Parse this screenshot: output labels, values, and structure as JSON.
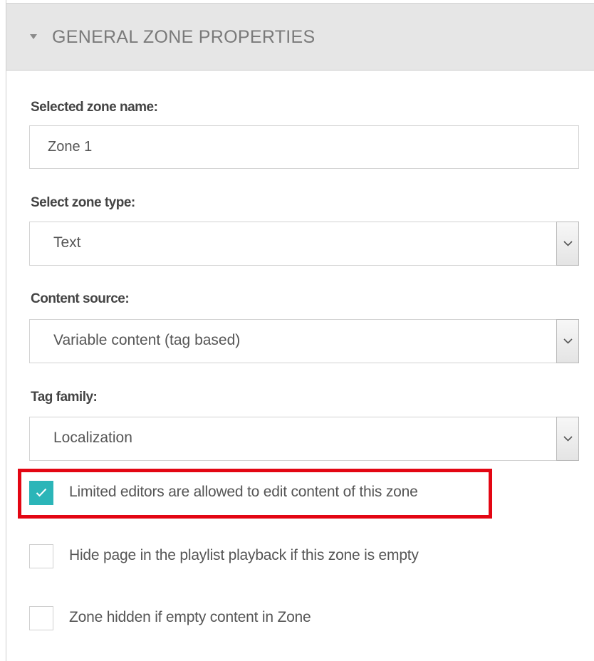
{
  "panel": {
    "title": "GENERAL ZONE PROPERTIES"
  },
  "fields": {
    "zone_name": {
      "label": "Selected zone name:",
      "value": "Zone 1"
    },
    "zone_type": {
      "label": "Select zone type:",
      "value": "Text"
    },
    "content_source": {
      "label": "Content source:",
      "value": "Variable content (tag based)"
    },
    "tag_family": {
      "label": "Tag family:",
      "value": "Localization"
    }
  },
  "checkboxes": [
    {
      "label": "Limited editors are allowed to edit content of this zone",
      "checked": true
    },
    {
      "label": "Hide page in the playlist playback if this zone is empty",
      "checked": false
    },
    {
      "label": "Zone hidden if empty content in Zone",
      "checked": false
    }
  ],
  "colors": {
    "accent": "#2bb5b8",
    "highlight": "#e30613",
    "header_background": "#e6e6e6"
  },
  "icons": {
    "collapse": "caret-down-icon",
    "select": "chevron-down-icon",
    "checked": "checkmark-icon"
  }
}
